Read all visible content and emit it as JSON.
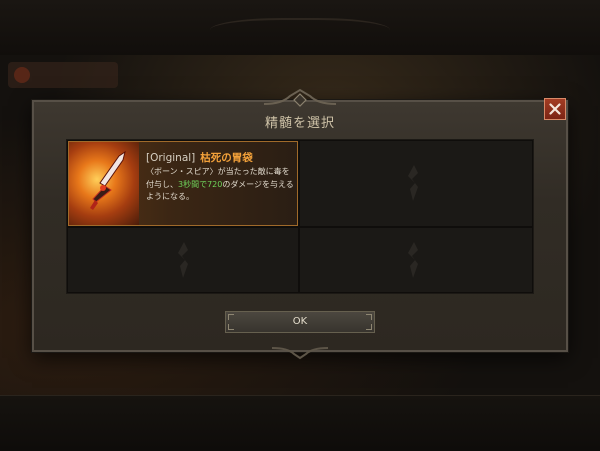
{
  "dialog": {
    "title": "精髄を選択",
    "close_icon": "close-icon",
    "ok_label": "OK"
  },
  "selected_item": {
    "tag": "[Original]",
    "name": "枯死の胃袋",
    "desc_before": "〈ボーン・スピア〉が当たった敵に毒を付与し、",
    "desc_duration": "3秒間で",
    "desc_damage": "720",
    "desc_after": "のダメージを与えるようになる。",
    "image_icon": "spear-icon"
  },
  "empty_slot_icon": "essence-emblem-icon",
  "colors": {
    "item_name": "#f3a13a",
    "highlight_green": "#6fd35a",
    "close_button": "#9a3520",
    "selected_border": "#a06a2a"
  }
}
